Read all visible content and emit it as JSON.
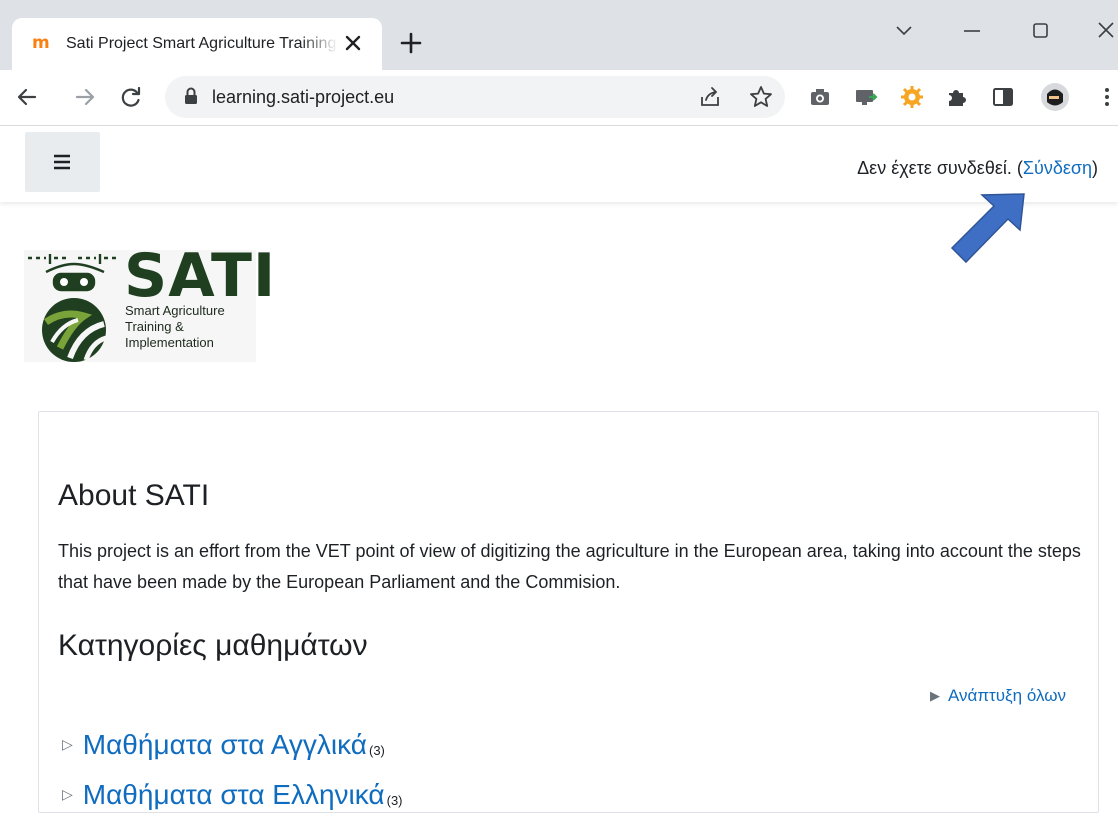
{
  "browser": {
    "tab_title": "Sati Project Smart Agriculture Training & Implementation",
    "favicon": "moodle-icon",
    "url": "learning.sati-project.eu"
  },
  "header": {
    "not_logged_in": "Δεν έχετε συνδεθεί. (",
    "login_link": "Σύνδεση",
    "close_paren": ")"
  },
  "logo": {
    "name": "SATI",
    "tagline_1": "Smart Agriculture",
    "tagline_2": "Training &",
    "tagline_3": "Implementation"
  },
  "main": {
    "about_title": "About SATI",
    "about_text": "This project is an effort from the VET  point of view of digitizing the agriculture in the European area, taking into account the steps that have been made by the European Parliament and the Commision.",
    "categories_title": "Κατηγορίες μαθημάτων",
    "expand_all": "Ανάπτυξη όλων",
    "categories": [
      {
        "name": "Μαθήματα στα Αγγλικά",
        "count": "(3)"
      },
      {
        "name": "Μαθήματα στα Ελληνικά",
        "count": "(3)"
      }
    ]
  },
  "colors": {
    "link": "#0f6cbf",
    "logo_green": "#1f3f20",
    "annotation_arrow": "#3f6fc4"
  }
}
